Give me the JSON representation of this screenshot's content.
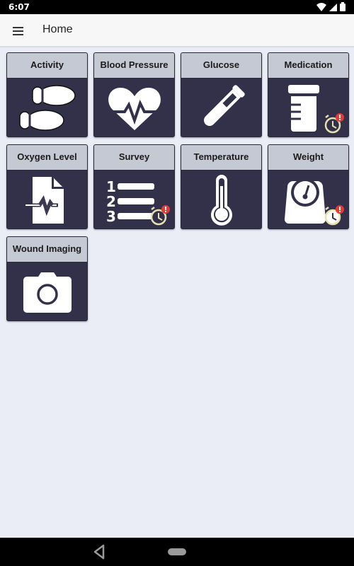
{
  "status_bar": {
    "time": "6:07",
    "icons": [
      "wifi-icon",
      "signal-icon",
      "battery-icon"
    ]
  },
  "app_bar": {
    "menu_icon": "hamburger-menu-icon",
    "title": "Home"
  },
  "tiles": [
    {
      "label": "Activity",
      "icon": "footprints-icon",
      "reminder": false
    },
    {
      "label": "Blood Pressure",
      "icon": "heart-pulse-icon",
      "reminder": false
    },
    {
      "label": "Glucose",
      "icon": "test-tube-icon",
      "reminder": false
    },
    {
      "label": "Medication",
      "icon": "pill-bottle-icon",
      "reminder": true
    },
    {
      "label": "Oxygen Level",
      "icon": "document-pulse-icon",
      "reminder": false
    },
    {
      "label": "Survey",
      "icon": "numbered-list-icon",
      "reminder": true
    },
    {
      "label": "Temperature",
      "icon": "thermometer-icon",
      "reminder": false
    },
    {
      "label": "Weight",
      "icon": "scale-icon",
      "reminder": true
    },
    {
      "label": "Wound Imaging",
      "icon": "camera-icon",
      "reminder": false
    }
  ],
  "reminder_badge": {
    "icon": "alarm-clock-alert-icon",
    "symbol": "!",
    "badge_color": "#e53935",
    "clock_color": "#e6e2b0"
  },
  "colors": {
    "tile_body": "#33304a",
    "tile_header": "#c4c9d4",
    "background": "#eaedf6"
  },
  "nav_bar": {
    "back_icon": "back-triangle-icon",
    "home_icon": "home-pill-icon"
  }
}
